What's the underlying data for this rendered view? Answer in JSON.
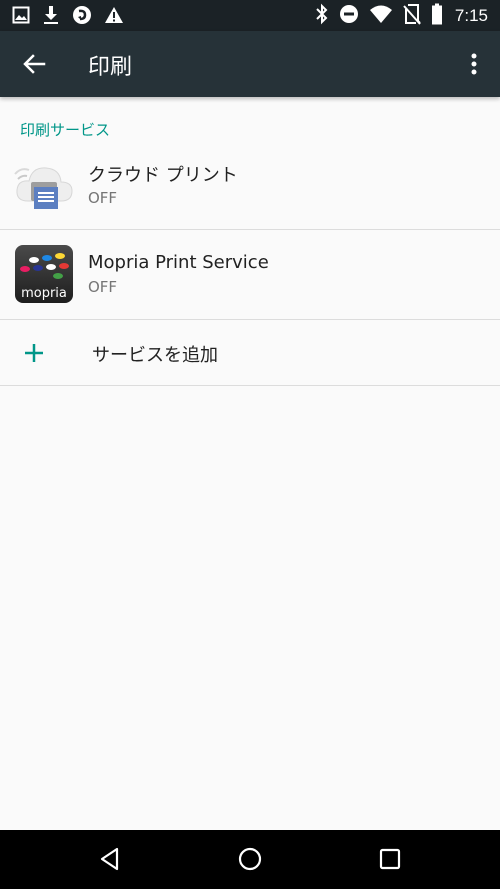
{
  "status_bar": {
    "time": "7:15",
    "left_icons": [
      "image-icon",
      "download-icon",
      "sync-app-icon",
      "warning-icon"
    ],
    "right_icons": [
      "bluetooth-icon",
      "do-not-disturb-icon",
      "wifi-icon",
      "no-sim-icon",
      "battery-icon"
    ]
  },
  "app_bar": {
    "title": "印刷",
    "back_icon": "arrow-back-icon",
    "overflow_icon": "more-vert-icon",
    "background": "#263238"
  },
  "section": {
    "header": "印刷サービス",
    "accent_color": "#009688"
  },
  "services": [
    {
      "name": "クラウド プリント",
      "status": "OFF",
      "icon": "cloud-print-icon"
    },
    {
      "name": "Mopria Print Service",
      "status": "OFF",
      "icon": "mopria-icon",
      "icon_text": "mopria"
    }
  ],
  "add_service": {
    "label": "サービスを追加",
    "icon": "plus-icon"
  },
  "nav_bar": {
    "buttons": [
      "back-triangle-icon",
      "home-circle-icon",
      "recents-square-icon"
    ]
  }
}
